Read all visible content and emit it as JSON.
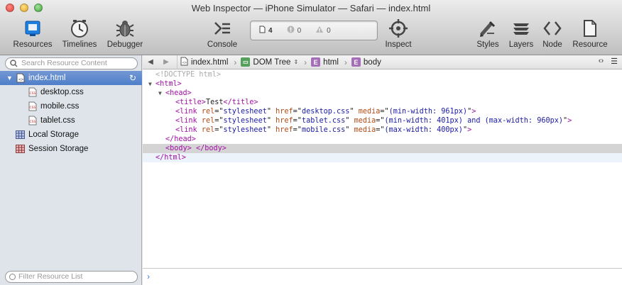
{
  "window": {
    "title": "Web Inspector — iPhone Simulator — Safari — index.html"
  },
  "toolbar": {
    "left": [
      {
        "label": "Resources",
        "icon": "resources-icon"
      },
      {
        "label": "Timelines",
        "icon": "timelines-icon"
      },
      {
        "label": "Debugger",
        "icon": "debugger-icon"
      }
    ],
    "console_label": "Console",
    "activity": {
      "resources": "4",
      "errors": "0",
      "warnings": "0"
    },
    "inspect_label": "Inspect",
    "right": [
      {
        "label": "Styles",
        "icon": "styles-icon"
      },
      {
        "label": "Layers",
        "icon": "layers-icon"
      },
      {
        "label": "Node",
        "icon": "node-icon"
      },
      {
        "label": "Resource",
        "icon": "resource-icon"
      }
    ]
  },
  "sidebar": {
    "search_placeholder": "Search Resource Content",
    "items": [
      {
        "label": "index.html",
        "selected": true,
        "type": "html"
      },
      {
        "label": "desktop.css",
        "type": "css"
      },
      {
        "label": "mobile.css",
        "type": "css"
      },
      {
        "label": "tablet.css",
        "type": "css"
      },
      {
        "label": "Local Storage",
        "type": "storage"
      },
      {
        "label": "Session Storage",
        "type": "storage"
      }
    ],
    "filter_placeholder": "Filter Resource List"
  },
  "navbar": {
    "crumbs": [
      {
        "label": "index.html"
      },
      {
        "label": "DOM Tree"
      },
      {
        "label": "html"
      },
      {
        "label": "body"
      }
    ]
  },
  "dom": {
    "doctype": "<!DOCTYPE html>",
    "html_open": "<html>",
    "head_open": "<head>",
    "title_open": "<title>",
    "title_text": "Test",
    "title_close": "</title>",
    "links": [
      {
        "href": "desktop.css",
        "media": "(min-width: 961px)"
      },
      {
        "href": "tablet.css",
        "media": "(min-width: 401px) and (max-width: 960px)"
      },
      {
        "href": "mobile.css",
        "media": "(max-width: 400px)"
      }
    ],
    "link_tag": "<link",
    "rel_attr": "rel",
    "rel_val": "stylesheet",
    "href_attr": "href",
    "media_attr": "media",
    "tag_end": ">",
    "head_close": "</head>",
    "body_open": "<body>",
    "body_close": "</body>",
    "html_close": "</html>"
  },
  "console": {
    "prompt": "›"
  }
}
